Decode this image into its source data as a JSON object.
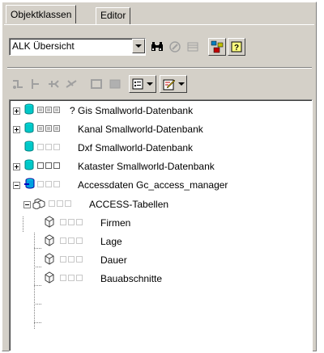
{
  "tabs": [
    {
      "label": "Objektklassen",
      "active": true
    },
    {
      "label": "Editor",
      "active": false
    }
  ],
  "toolbar": {
    "combo_value": "ALK Übersicht",
    "row1_icons": [
      "binoculars-icon",
      "tool-icon",
      "grid-icon",
      "network-icon",
      "help-icon"
    ],
    "row2_icons": [
      "split-icon",
      "merge-icon",
      "add-icon",
      "remove-icon",
      "copy-icon",
      "paste-icon",
      "list-icon",
      "edit-icon"
    ]
  },
  "tree": {
    "nodes": [
      {
        "label": "? Gis Smallworld-Datenbank",
        "icon": "database-icon",
        "expander": "plus",
        "checks": "on"
      },
      {
        "label": "Kanal Smallworld-Datenbank",
        "icon": "database-icon",
        "expander": "plus",
        "checks": "on"
      },
      {
        "label": "Dxf Smallworld-Datenbank",
        "icon": "database-icon",
        "expander": "none",
        "checks": "off"
      },
      {
        "label": "Kataster Smallworld-Datenbank",
        "icon": "database-icon",
        "expander": "plus",
        "checks": "offdark"
      },
      {
        "label": "Accessdaten Gc_access_manager",
        "icon": "access-database-icon",
        "expander": "minus",
        "checks": "off"
      },
      {
        "label": "ACCESS-Tabellen",
        "icon": "object-group-icon",
        "expander": "minus",
        "checks": "off"
      },
      {
        "label": "Firmen",
        "icon": "object-class-icon",
        "expander": "none",
        "checks": "off"
      },
      {
        "label": "Lage",
        "icon": "object-class-icon",
        "expander": "none",
        "checks": "off"
      },
      {
        "label": "Dauer",
        "icon": "object-class-icon",
        "expander": "none",
        "checks": "off"
      },
      {
        "label": "Bauabschnitte",
        "icon": "object-class-icon",
        "expander": "none",
        "checks": "off"
      }
    ]
  },
  "colors": {
    "face": "#d4d0c8",
    "db_cyan": "#00c8c8",
    "db_blue": "#0000c0"
  }
}
